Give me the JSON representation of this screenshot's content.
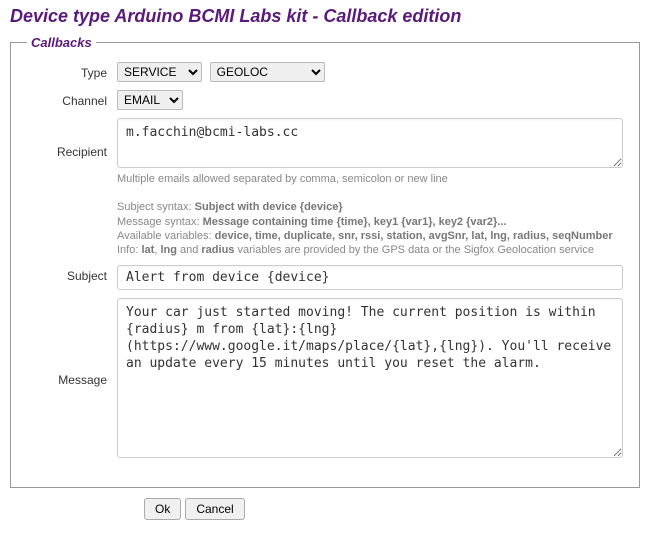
{
  "title": "Device type Arduino BCMI Labs kit - Callback edition",
  "fieldsetLegend": "Callbacks",
  "labels": {
    "type": "Type",
    "channel": "Channel",
    "recipient": "Recipient",
    "subject": "Subject",
    "message": "Message"
  },
  "type": {
    "selected": "SERVICE",
    "sub_selected": "GEOLOC"
  },
  "channel": {
    "selected": "EMAIL"
  },
  "recipient": {
    "value": "m.facchin@bcmi-labs.cc",
    "help": "Multiple emails allowed separated by comma, semicolon or new line"
  },
  "syntax": {
    "subject_prefix": "Subject syntax: ",
    "subject_bold": "Subject with device {device}",
    "message_prefix": "Message syntax: ",
    "message_bold": "Message containing time {time}, key1 {var1}, key2 {var2}...",
    "vars_prefix": "Available variables: ",
    "vars_bold": "device, time, duplicate, snr, rssi, station, avgSnr, lat, lng, radius, seqNumber",
    "info_prefix": "Info: ",
    "info_b1": "lat",
    "info_sep": ", ",
    "info_b2": "lng",
    "info_and": " and ",
    "info_b3": "radius",
    "info_tail": " variables are provided by the GPS data or the Sigfox Geolocation service"
  },
  "subject": {
    "value": "Alert from device {device}"
  },
  "message": {
    "value": "Your car just started moving! The current position is within {radius} m from {lat}:{lng} (https://www.google.it/maps/place/{lat},{lng}). You'll receive an update every 15 minutes until you reset the alarm."
  },
  "buttons": {
    "ok": "Ok",
    "cancel": "Cancel"
  }
}
